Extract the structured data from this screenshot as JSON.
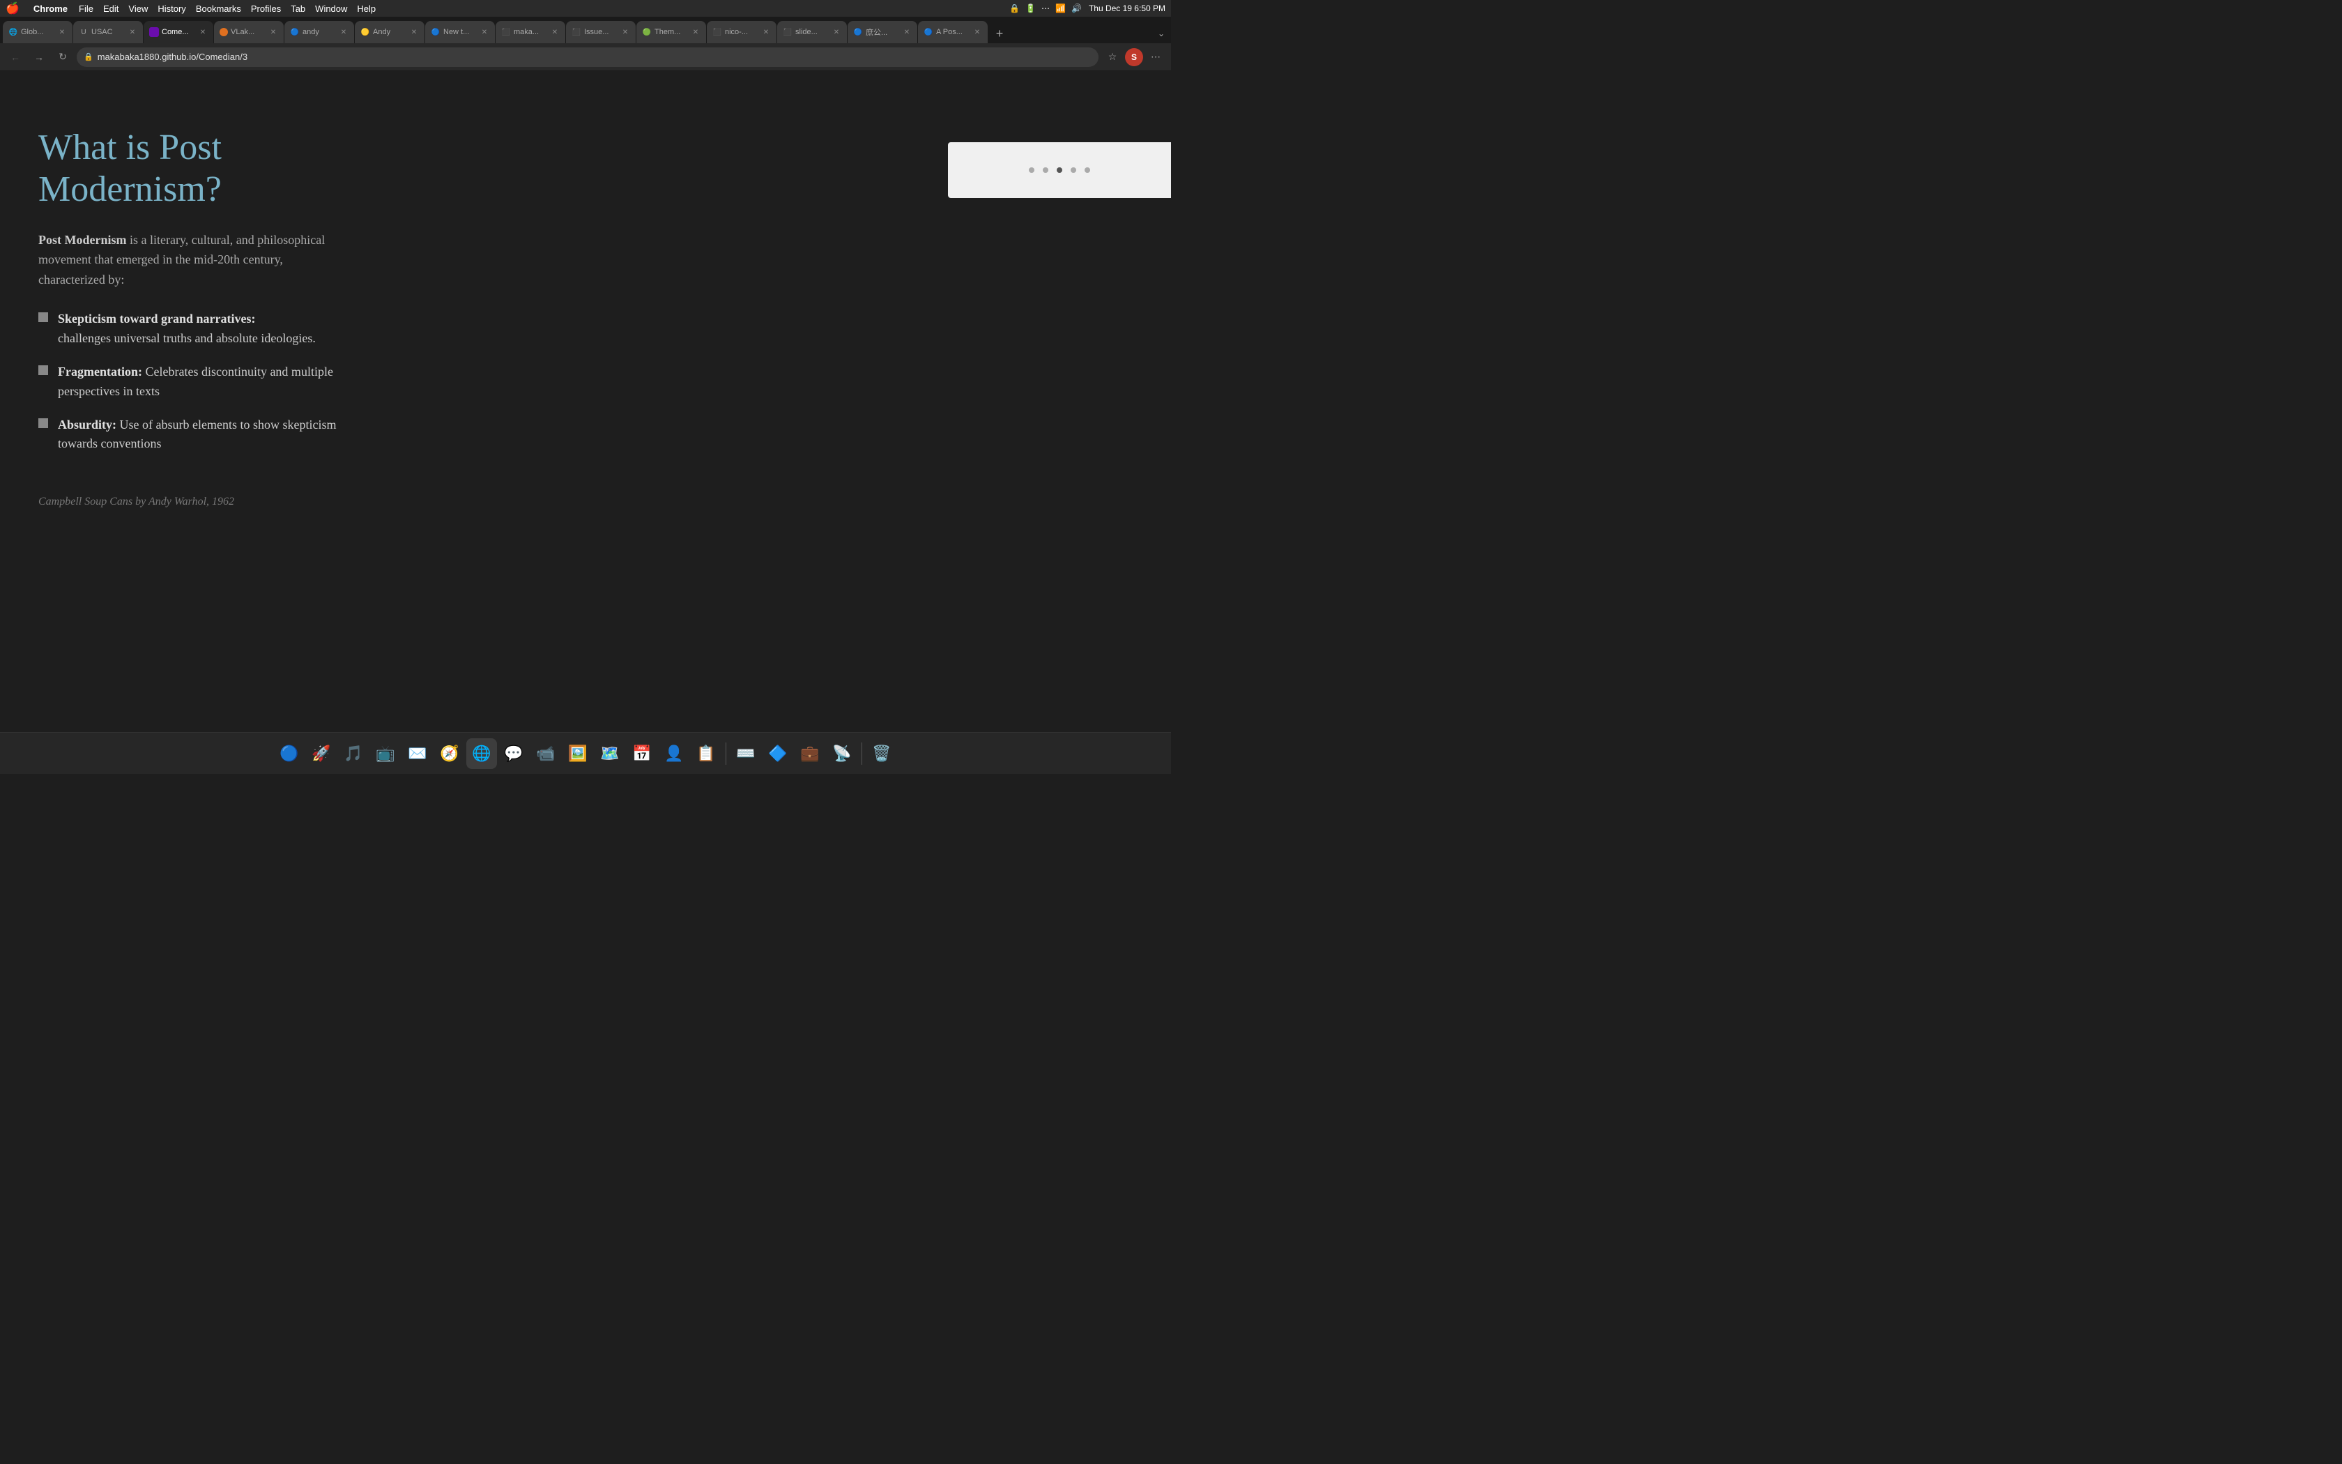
{
  "menubar": {
    "apple": "🍎",
    "app": "Chrome",
    "items": [
      "File",
      "Edit",
      "View",
      "History",
      "Bookmarks",
      "Profiles",
      "Tab",
      "Window",
      "Help"
    ],
    "time": "Thu Dec 19  6:50 PM"
  },
  "tabs": [
    {
      "id": "global",
      "label": "Glob...",
      "favicon": "🌐",
      "active": false
    },
    {
      "id": "usac",
      "label": "USAC",
      "favicon": "🔵",
      "active": false
    },
    {
      "id": "comedian",
      "label": "Come...",
      "favicon": "🟣",
      "active": true
    },
    {
      "id": "vlak",
      "label": "VLak...",
      "favicon": "🟠",
      "active": false
    },
    {
      "id": "andy",
      "label": "andy",
      "favicon": "🔵",
      "active": false
    },
    {
      "id": "andy2",
      "label": "Andy",
      "favicon": "🟡",
      "active": false
    },
    {
      "id": "new",
      "label": "New t...",
      "favicon": "🔵",
      "active": false
    },
    {
      "id": "maka",
      "label": "maka...",
      "favicon": "⬛",
      "active": false
    },
    {
      "id": "issue",
      "label": "Issue...",
      "favicon": "⬛",
      "active": false
    },
    {
      "id": "them",
      "label": "Them...",
      "favicon": "🟢",
      "active": false
    },
    {
      "id": "nico",
      "label": "nico-...",
      "favicon": "⬛",
      "active": false
    },
    {
      "id": "slide",
      "label": "slide...",
      "favicon": "⬛",
      "active": false
    },
    {
      "id": "cht",
      "label": "庶公...",
      "favicon": "🔵",
      "active": false
    },
    {
      "id": "apos",
      "label": "A Pos...",
      "favicon": "🔵",
      "active": false
    }
  ],
  "toolbar": {
    "url": "makabaka1880.github.io/Comedian/3",
    "back_disabled": false,
    "forward_disabled": false
  },
  "slide": {
    "title": "What is Post Modernism?",
    "intro_prefix": "Post Modernism",
    "intro_text": " is a literary, cultural, and philosophical movement that emerged in the mid-20th century, characterized by:",
    "bullets": [
      {
        "term": "Skepticism toward grand narratives:",
        "description": "challenges universal truths and absolute ideologies."
      },
      {
        "term": "Fragmentation:",
        "description": "Celebrates discontinuity and multiple perspectives in texts"
      },
      {
        "term": "Absurdity:",
        "description": "Use of absurb elements to show skepticism towards conventions"
      }
    ],
    "caption_italic": "Campbell Soup Cans",
    "caption_rest": " by Andy Warhol, 1962"
  }
}
